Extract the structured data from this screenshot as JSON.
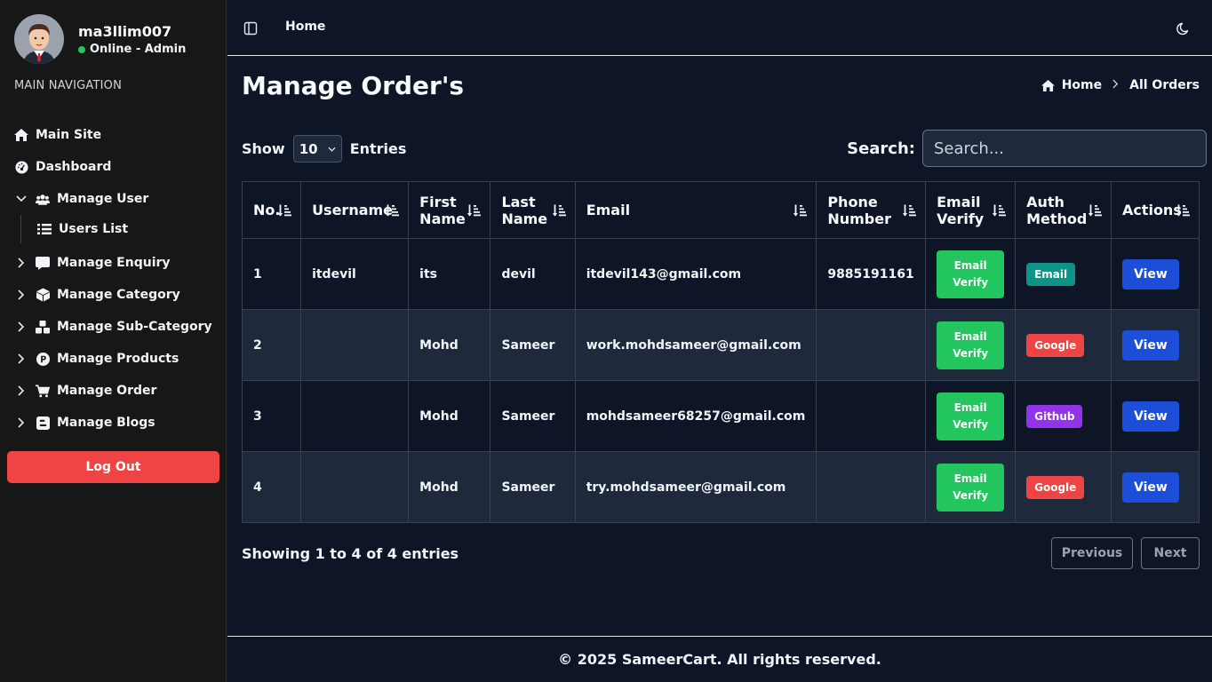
{
  "sidebar": {
    "user": {
      "name": "ma3llim007",
      "status": "Online - Admin"
    },
    "nav_header": "MAIN NAVIGATION",
    "items": [
      {
        "label": "Main Site",
        "icon": "home-icon"
      },
      {
        "label": "Dashboard",
        "icon": "gauge-icon"
      },
      {
        "label": "Manage User",
        "icon": "users-icon",
        "expanded": true
      },
      {
        "label": "Users List",
        "icon": "list-icon"
      },
      {
        "label": "Manage Enquiry",
        "icon": "message-icon"
      },
      {
        "label": "Manage Category",
        "icon": "box-icon"
      },
      {
        "label": "Manage Sub-Category",
        "icon": "cubes-icon"
      },
      {
        "label": "Manage Products",
        "icon": "product-icon"
      },
      {
        "label": "Manage Order",
        "icon": "cart-icon"
      },
      {
        "label": "Manage Blogs",
        "icon": "blog-icon"
      }
    ],
    "logout_label": "Log Out"
  },
  "topbar": {
    "title": "Home"
  },
  "page": {
    "title": "Manage Order's",
    "breadcrumb": [
      "Home",
      "All Orders"
    ]
  },
  "controls": {
    "show_label": "Show",
    "entries_value": "10",
    "entries_label": "Entries",
    "search_label": "Search:",
    "search_placeholder": "Search..."
  },
  "table": {
    "headers": [
      [
        "No."
      ],
      [
        "Username"
      ],
      [
        "First",
        "Name"
      ],
      [
        "Last",
        "Name"
      ],
      [
        "Email"
      ],
      [
        "Phone",
        "Number"
      ],
      [
        "Email",
        "Verify"
      ],
      [
        "Auth",
        "Method"
      ],
      [
        "Actions"
      ]
    ],
    "rows": [
      {
        "no": "1",
        "username": "itdevil",
        "first": "its",
        "last": "devil",
        "email": "itdevil143@gmail.com",
        "phone": "9885191161",
        "verify": [
          "Email",
          "Verify"
        ],
        "auth": "Email",
        "auth_color": "#0d9488",
        "action": "View"
      },
      {
        "no": "2",
        "username": "",
        "first": "Mohd",
        "last": "Sameer",
        "email": "work.mohdsameer@gmail.com",
        "phone": "",
        "verify": [
          "Email",
          "Verify"
        ],
        "auth": "Google",
        "auth_color": "#ef4444",
        "action": "View"
      },
      {
        "no": "3",
        "username": "",
        "first": "Mohd",
        "last": "Sameer",
        "email": "mohdsameer68257@gmail.com",
        "phone": "",
        "verify": [
          "Email",
          "Verify"
        ],
        "auth": "Github",
        "auth_color": "#9333ea",
        "action": "View"
      },
      {
        "no": "4",
        "username": "",
        "first": "Mohd",
        "last": "Sameer",
        "email": "try.mohdsameer@gmail.com",
        "phone": "",
        "verify": [
          "Email",
          "Verify"
        ],
        "auth": "Google",
        "auth_color": "#ef4444",
        "action": "View"
      }
    ]
  },
  "pagination": {
    "info": "Showing 1 to 4 of 4 entries",
    "previous": "Previous",
    "next": "Next"
  },
  "footer": {
    "text": "© 2025 SameerCart. All rights reserved."
  }
}
